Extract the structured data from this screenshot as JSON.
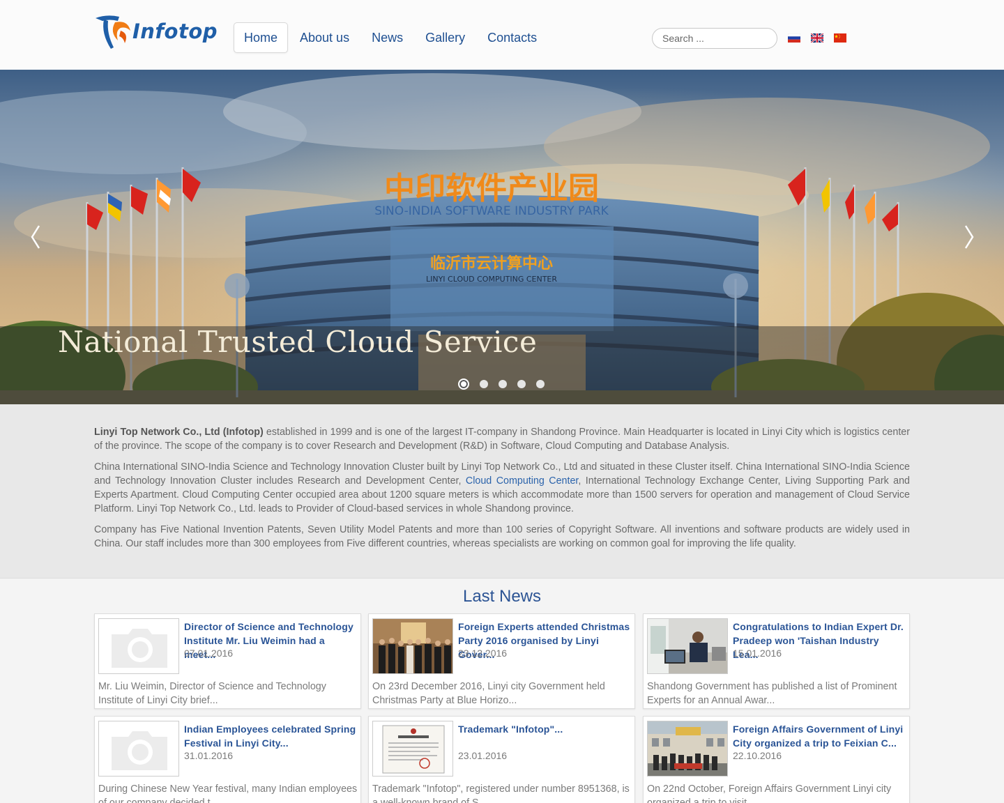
{
  "header": {
    "logo_text": "Infotop",
    "nav": [
      {
        "label": "Home",
        "active": true
      },
      {
        "label": "About us",
        "active": false
      },
      {
        "label": "News",
        "active": false
      },
      {
        "label": "Gallery",
        "active": false
      },
      {
        "label": "Contacts",
        "active": false
      }
    ],
    "search_placeholder": "Search ...",
    "languages": [
      "ru-flag-icon",
      "uk-flag-icon",
      "cn-flag-icon"
    ]
  },
  "hero": {
    "caption": "National Trusted Cloud Service",
    "slide_count": 5,
    "active_slide": 1,
    "sign_cn": "中印软件产业园",
    "sign_en": "SINO-INDIA SOFTWARE INDUSTRY PARK",
    "building_cn": "临沂市云计算中心",
    "building_en": "LINYI CLOUD COMPUTING CENTER"
  },
  "about": {
    "p1_bold": "Linyi Top Network Co., Ltd (Infotop)",
    "p1_rest": " established in 1999 and is one of the largest IT-company in Shandong Province. Main Headquarter is located in Linyi City which is logistics center of the province. The scope of the company is to cover Research and Development (R&D) in Software, Cloud Computing and Database Analysis.",
    "p2_before": "China International SINO-India Science and Technology Innovation Cluster built by Linyi Top Network Co., Ltd and situated in these Cluster itself. China International SINO-India Science and Technology Innovation Cluster includes Research and Development Center, ",
    "p2_link": "Cloud Computing Center",
    "p2_after": ", International Technology Exchange Center, Living Supporting Park and Experts Apartment. Cloud Computing Center occupied area about 1200 square meters is which accommodate more than 1500 servers for operation and management of Cloud Service Platform. Linyi Top Network Co., Ltd. leads to Provider of Cloud-based services in whole Shandong  province.",
    "p3": "Company has Five National Invention Patents, Seven Utility Model Patents and more than 100 series of Copyright Software. All inventions and software products are widely used in China. Our staff includes more than 300 employees from Five different countries, whereas specialists are working on common goal for improving the life quality."
  },
  "news": {
    "title": "Last News",
    "items": [
      {
        "title": "Director of Science and Technology Institute Mr. Liu Weimin had a meet...",
        "date": "07.01.2016",
        "excerpt": "Mr. Liu Weimin, Director of Science and Technology Institute of Linyi City brief...",
        "thumb": "camera-placeholder-icon"
      },
      {
        "title": "Foreign Experts attended Christmas Party 2016 organised by Linyi Gover...",
        "date": "23.12.2016",
        "excerpt": "On 23rd December 2016, Linyi city Government held Christmas Party at Blue Horizo...",
        "thumb": "group-photo"
      },
      {
        "title": "Congratulations to Indian Expert Dr. Pradeep won 'Taishan Industry Lea...",
        "date": "15.01.2016",
        "excerpt": "Shandong Government has published a list of Prominent Experts for an Annual Awar...",
        "thumb": "office-photo"
      },
      {
        "title": "Indian Employees celebrated Spring Festival in Linyi City...",
        "date": "31.01.2016",
        "excerpt": "During Chinese New Year festival, many Indian employees of our company decided t...",
        "thumb": "camera-placeholder-icon"
      },
      {
        "title": "Trademark \"Infotop\"...",
        "date": "23.01.2016",
        "excerpt": "Trademark \"Infotop\", registered under number 8951368, is a well-known brand of S...",
        "thumb": "certificate-photo"
      },
      {
        "title": "Foreign Affairs Government of Linyi City organized a trip to Feixian C...",
        "date": "22.10.2016",
        "excerpt": "On 22nd October, Foreign Affairs Government Linyi city organized a trip to visit...",
        "thumb": "group-outdoor-photo"
      }
    ]
  }
}
